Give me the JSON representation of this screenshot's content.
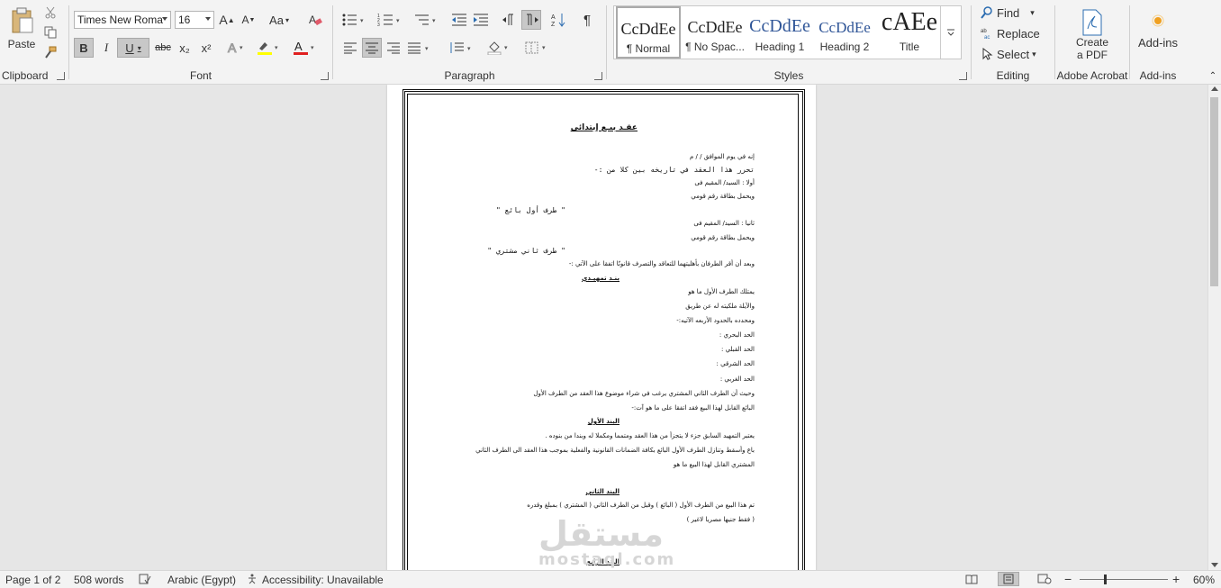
{
  "ribbon": {
    "clipboard": {
      "paste_label": "Paste",
      "group_label": "Clipboard"
    },
    "font": {
      "font_name": "Times New Roma",
      "font_size": "16",
      "bold": "B",
      "italic": "I",
      "underline": "U",
      "strike": "abc",
      "subscript": "x₂",
      "superscript": "x²",
      "grow": "A",
      "shrink": "A",
      "change_case": "Aa",
      "group_label": "Font"
    },
    "paragraph": {
      "group_label": "Paragraph"
    },
    "styles": {
      "group_label": "Styles",
      "items": [
        {
          "preview": "CcDdEe",
          "name": "¶ Normal"
        },
        {
          "preview": "CcDdEe",
          "name": "¶ No Spac..."
        },
        {
          "preview": "CcDdEe",
          "name": "Heading 1"
        },
        {
          "preview": "CcDdEe",
          "name": "Heading 2"
        },
        {
          "preview": "cAEe",
          "name": "Title"
        }
      ]
    },
    "editing": {
      "find": "Find",
      "replace": "Replace",
      "select": "Select",
      "group_label": "Editing"
    },
    "acrobat": {
      "create_line1": "Create",
      "create_line2": "a PDF",
      "group_label": "Adobe Acrobat"
    },
    "addins": {
      "label": "Add-ins",
      "group_label": "Add-ins"
    }
  },
  "document": {
    "title": "عقـد بيـع إبتدائي",
    "lines": [
      "إنه في يوم                    الموافق      /      /        م",
      "تحرر هذا العقد في تاريخه بين كلا من :-",
      "أولا : السيد/                              المقيم فى",
      "ويحمل بطاقة رقم قومي",
      "\" طرف أول بائع \"",
      "ثانيا : السيد/                               المقيم فى",
      "ويحمل بطاقة رقم قومي",
      "\" طرف ثاني مشتري \"",
      "وبعد أن أقر الطرفان بأهليتهما للتعاقد والتصرف قانونًا اتفقا على الآتي :-",
      "بنـد تمهيـدي",
      "يمتلك الطرف الأول ما هو",
      "والآيلة ملكيته له عن طريق",
      "ومحدده بالحدود الأربعه الآتيه:-",
      "الحد البحري :",
      "الحد القبلي  :",
      "الحد الشرقي :",
      "الحد الغربي :",
      "وحيث أن الطرف الثاني المشتري يرغب في شراء                       موضوع هذا العقد من الطرف الأول",
      "البائع القابل لهذا البيع فقد اتفقا على ما هو آت:-",
      "البند الأول",
      "يعتبر التمهيد السابق جزء لا يتجزأ من هذا العقد ومتمما ومكملا له وبندا من بنوده .",
      "باع وأسقط وتنازل الطرف الأول البائع بكافة الضمانات القانونية والفعلية بموجب هذا العقد الى الطرف الثاني",
      "المشتري القابل لهذا البيع ما هو",
      "البند الثاني",
      "تم هذا البيع من الطرف الأول ( البائع ) وقبل من الطرف الثاني ( المشتري ) بمبلغ وقدره",
      "( فقط                                         جنيها مصريا لاغير )",
      "البند الرابع"
    ]
  },
  "watermark": {
    "top": "مستقل",
    "bottom": "mostaql.com"
  },
  "status": {
    "page": "Page 1 of 2",
    "words": "508 words",
    "language": "Arabic (Egypt)",
    "accessibility": "Accessibility: Unavailable",
    "zoom": "60%"
  }
}
